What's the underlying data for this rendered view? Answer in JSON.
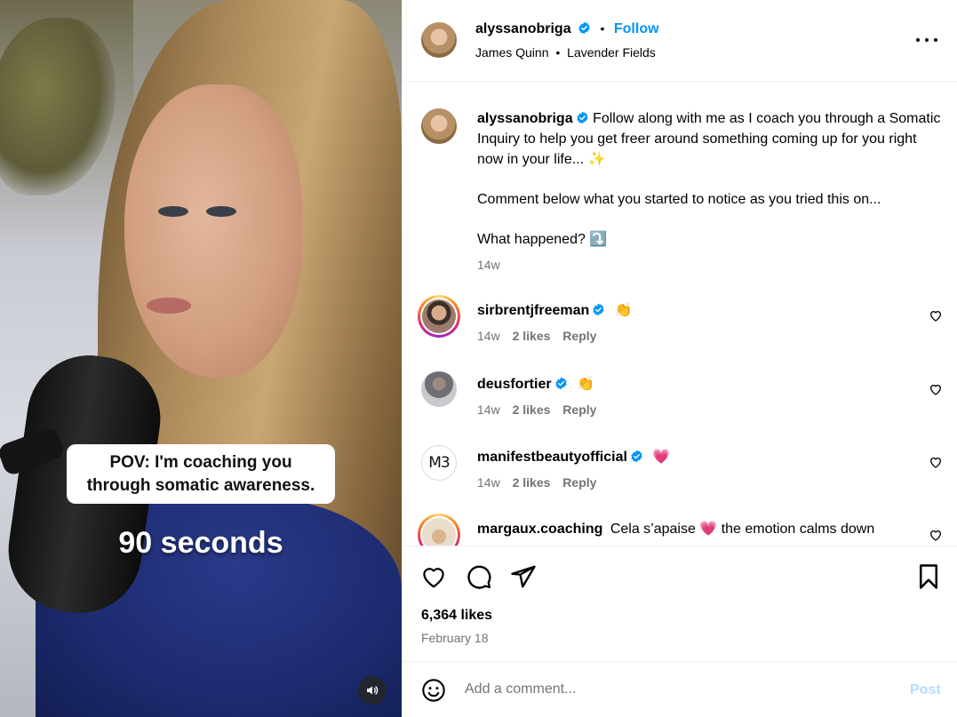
{
  "video": {
    "caption_box": "POV: I'm coaching you through somatic awareness.",
    "caption_big": "90 seconds",
    "sound_icon": "speaker-icon"
  },
  "header": {
    "username": "alyssanobriga",
    "separator": "•",
    "follow_label": "Follow",
    "audio_artist": "James Quinn",
    "audio_title": "Lavender Fields",
    "more_icon": "more-horizontal-icon"
  },
  "post": {
    "username": "alyssanobriga",
    "caption_line1": "Follow along with me as I coach you through a Somatic Inquiry to help you get freer around something coming up for you right now in your life... ✨",
    "caption_line2": "Comment below what you started to notice as you tried this on...",
    "caption_line3": "What happened? ⤵️",
    "time": "14w"
  },
  "comments": [
    {
      "username": "sirbrentjfreeman",
      "text": "👏",
      "time": "14w",
      "likes": "2 likes",
      "reply": "Reply"
    },
    {
      "username": "deusfortier",
      "text": "👏",
      "time": "14w",
      "likes": "2 likes",
      "reply": "Reply"
    },
    {
      "username": "manifestbeautyofficial",
      "avatar_text": "M3",
      "text": "💗",
      "time": "14w",
      "likes": "2 likes",
      "reply": "Reply"
    },
    {
      "username": "margaux.coaching",
      "text": "Cela s’apaise 💗 the emotion calms down"
    }
  ],
  "actions": {
    "likes": "6,364 likes",
    "date": "February 18",
    "icons": [
      "heart-icon",
      "comment-icon",
      "share-icon",
      "bookmark-icon"
    ]
  },
  "comment_bar": {
    "placeholder": "Add a comment...",
    "post_label": "Post",
    "emoji_icon": "emoji-icon"
  },
  "colors": {
    "accent": "#0095f6",
    "verified": "#0095f6",
    "muted": "#737373",
    "post_disabled": "#b3dbff"
  }
}
